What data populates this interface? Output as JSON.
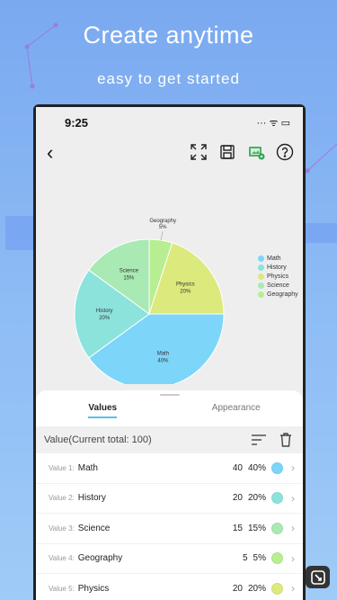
{
  "hero": {
    "title": "Create anytime",
    "subtitle": "easy to get started"
  },
  "status": {
    "time": "9:25",
    "right": "··· ᯤ ▭"
  },
  "nav": {
    "back": "‹"
  },
  "chart_data": {
    "type": "pie",
    "title": "",
    "slices": [
      {
        "label": "Math",
        "value": 40,
        "percent": "40%",
        "color": "#7dd5f9"
      },
      {
        "label": "History",
        "value": 20,
        "percent": "20%",
        "color": "#8be3dc"
      },
      {
        "label": "Science",
        "value": 15,
        "percent": "15%",
        "color": "#a8e9b4"
      },
      {
        "label": "Geography",
        "value": 5,
        "percent": "5%",
        "color": "#b8ee92"
      },
      {
        "label": "Physics",
        "value": 20,
        "percent": "20%",
        "color": "#dce97c"
      }
    ],
    "legend": [
      "Math",
      "History",
      "Physics",
      "Science",
      "Geography"
    ],
    "legend_position": "right"
  },
  "sheet": {
    "tabs": [
      {
        "label": "Values"
      },
      {
        "label": "Appearance"
      }
    ],
    "header_title": "Value(Current total: 100)",
    "rows": [
      {
        "prefix": "Value 1:",
        "name": "Math",
        "value": "40",
        "percent": "40%",
        "color": "#7dd5f9"
      },
      {
        "prefix": "Value 2:",
        "name": "History",
        "value": "20",
        "percent": "20%",
        "color": "#8be3dc"
      },
      {
        "prefix": "Value 3:",
        "name": "Science",
        "value": "15",
        "percent": "15%",
        "color": "#a8e9b4"
      },
      {
        "prefix": "Value 4:",
        "name": "Geography",
        "value": "5",
        "percent": "5%",
        "color": "#b8ee92"
      },
      {
        "prefix": "Value 5:",
        "name": "Physics",
        "value": "20",
        "percent": "20%",
        "color": "#dce97c"
      }
    ],
    "chevron": "›"
  }
}
